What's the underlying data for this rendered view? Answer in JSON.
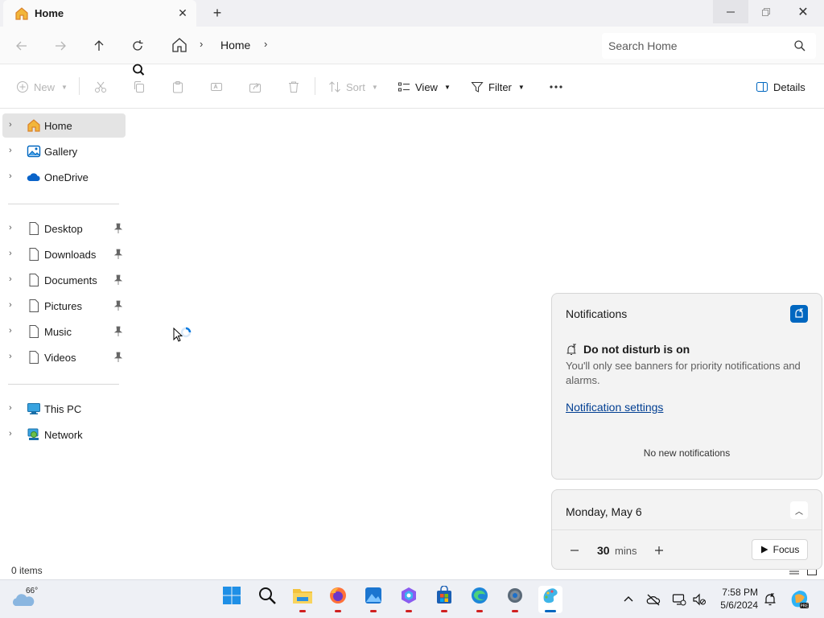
{
  "window": {
    "tab_title": "Home",
    "new_tab_symbol": "+",
    "close_symbol": "✕",
    "minimize_symbol": "—",
    "close_window_symbol": "✕"
  },
  "addressbar": {
    "breadcrumb": [
      "Home"
    ],
    "search_placeholder": "Search Home"
  },
  "commands": {
    "new": "New",
    "sort": "Sort",
    "view": "View",
    "filter": "Filter",
    "details": "Details"
  },
  "sidebar": {
    "quick": [
      {
        "label": "Home",
        "icon": "home-icon",
        "selected": true
      },
      {
        "label": "Gallery",
        "icon": "gallery-icon"
      },
      {
        "label": "OneDrive",
        "icon": "onedrive-icon"
      }
    ],
    "pinned": [
      {
        "label": "Desktop",
        "icon": "folder-icon"
      },
      {
        "label": "Downloads",
        "icon": "folder-icon"
      },
      {
        "label": "Documents",
        "icon": "folder-icon"
      },
      {
        "label": "Pictures",
        "icon": "folder-icon"
      },
      {
        "label": "Music",
        "icon": "folder-icon"
      },
      {
        "label": "Videos",
        "icon": "folder-icon"
      }
    ],
    "devices": [
      {
        "label": "This PC",
        "icon": "pc-icon"
      },
      {
        "label": "Network",
        "icon": "network-icon"
      }
    ]
  },
  "status": {
    "item_count": "0 items"
  },
  "notifications": {
    "title": "Notifications",
    "dnd_title": "Do not disturb is on",
    "dnd_text": "You'll only see banners for priority notifications and alarms.",
    "settings_link": "Notification settings",
    "empty_text": "No new notifications"
  },
  "calendar": {
    "date": "Monday, May 6",
    "focus_minutes": "30",
    "focus_unit": "mins",
    "focus_button": "Focus"
  },
  "taskbar": {
    "weather_temp": "66°",
    "time": "7:58 PM",
    "date": "5/6/2024",
    "colors": {
      "accent": "#0067c0",
      "indicator": "#d02020"
    }
  }
}
